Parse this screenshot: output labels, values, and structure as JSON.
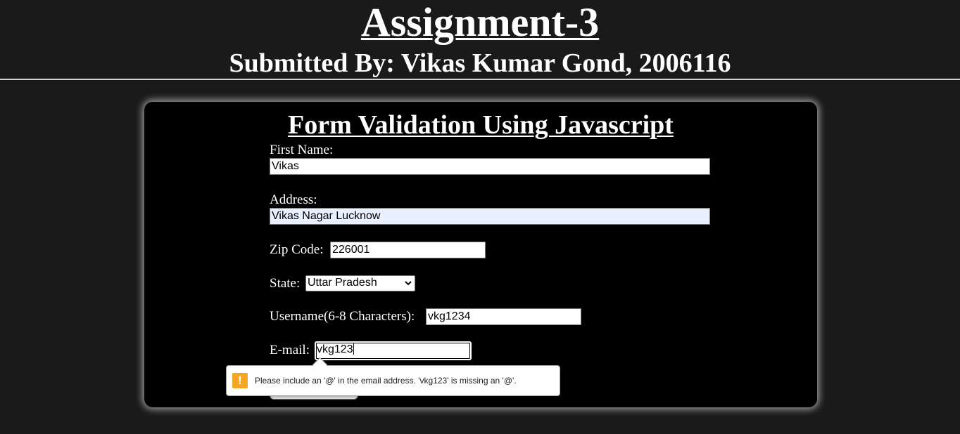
{
  "header": {
    "title": "Assignment-3",
    "subtitle": "Submitted By: Vikas Kumar Gond, 2006116"
  },
  "form": {
    "title": "Form Validation Using Javascript",
    "first_name": {
      "label": "First Name:",
      "value": "Vikas"
    },
    "address": {
      "label": "Address:",
      "value": "Vikas Nagar Lucknow"
    },
    "zip": {
      "label": "Zip Code:",
      "value": "226001"
    },
    "state": {
      "label": "State:",
      "selected": "Uttar Pradesh"
    },
    "username": {
      "label": "Username(6-8 Characters):",
      "value": "vkg1234"
    },
    "email": {
      "label": "E-mail:",
      "value": "vkg123"
    }
  },
  "validation_tooltip": {
    "icon": "warning-icon",
    "icon_glyph": "!",
    "message": "Please include an '@' in the email address. 'vkg123' is missing an '@'."
  },
  "colors": {
    "page_background": "#1a1a1a",
    "card_background": "#000000",
    "autofill_background": "#e8f0fe",
    "warning": "#f5a623"
  }
}
